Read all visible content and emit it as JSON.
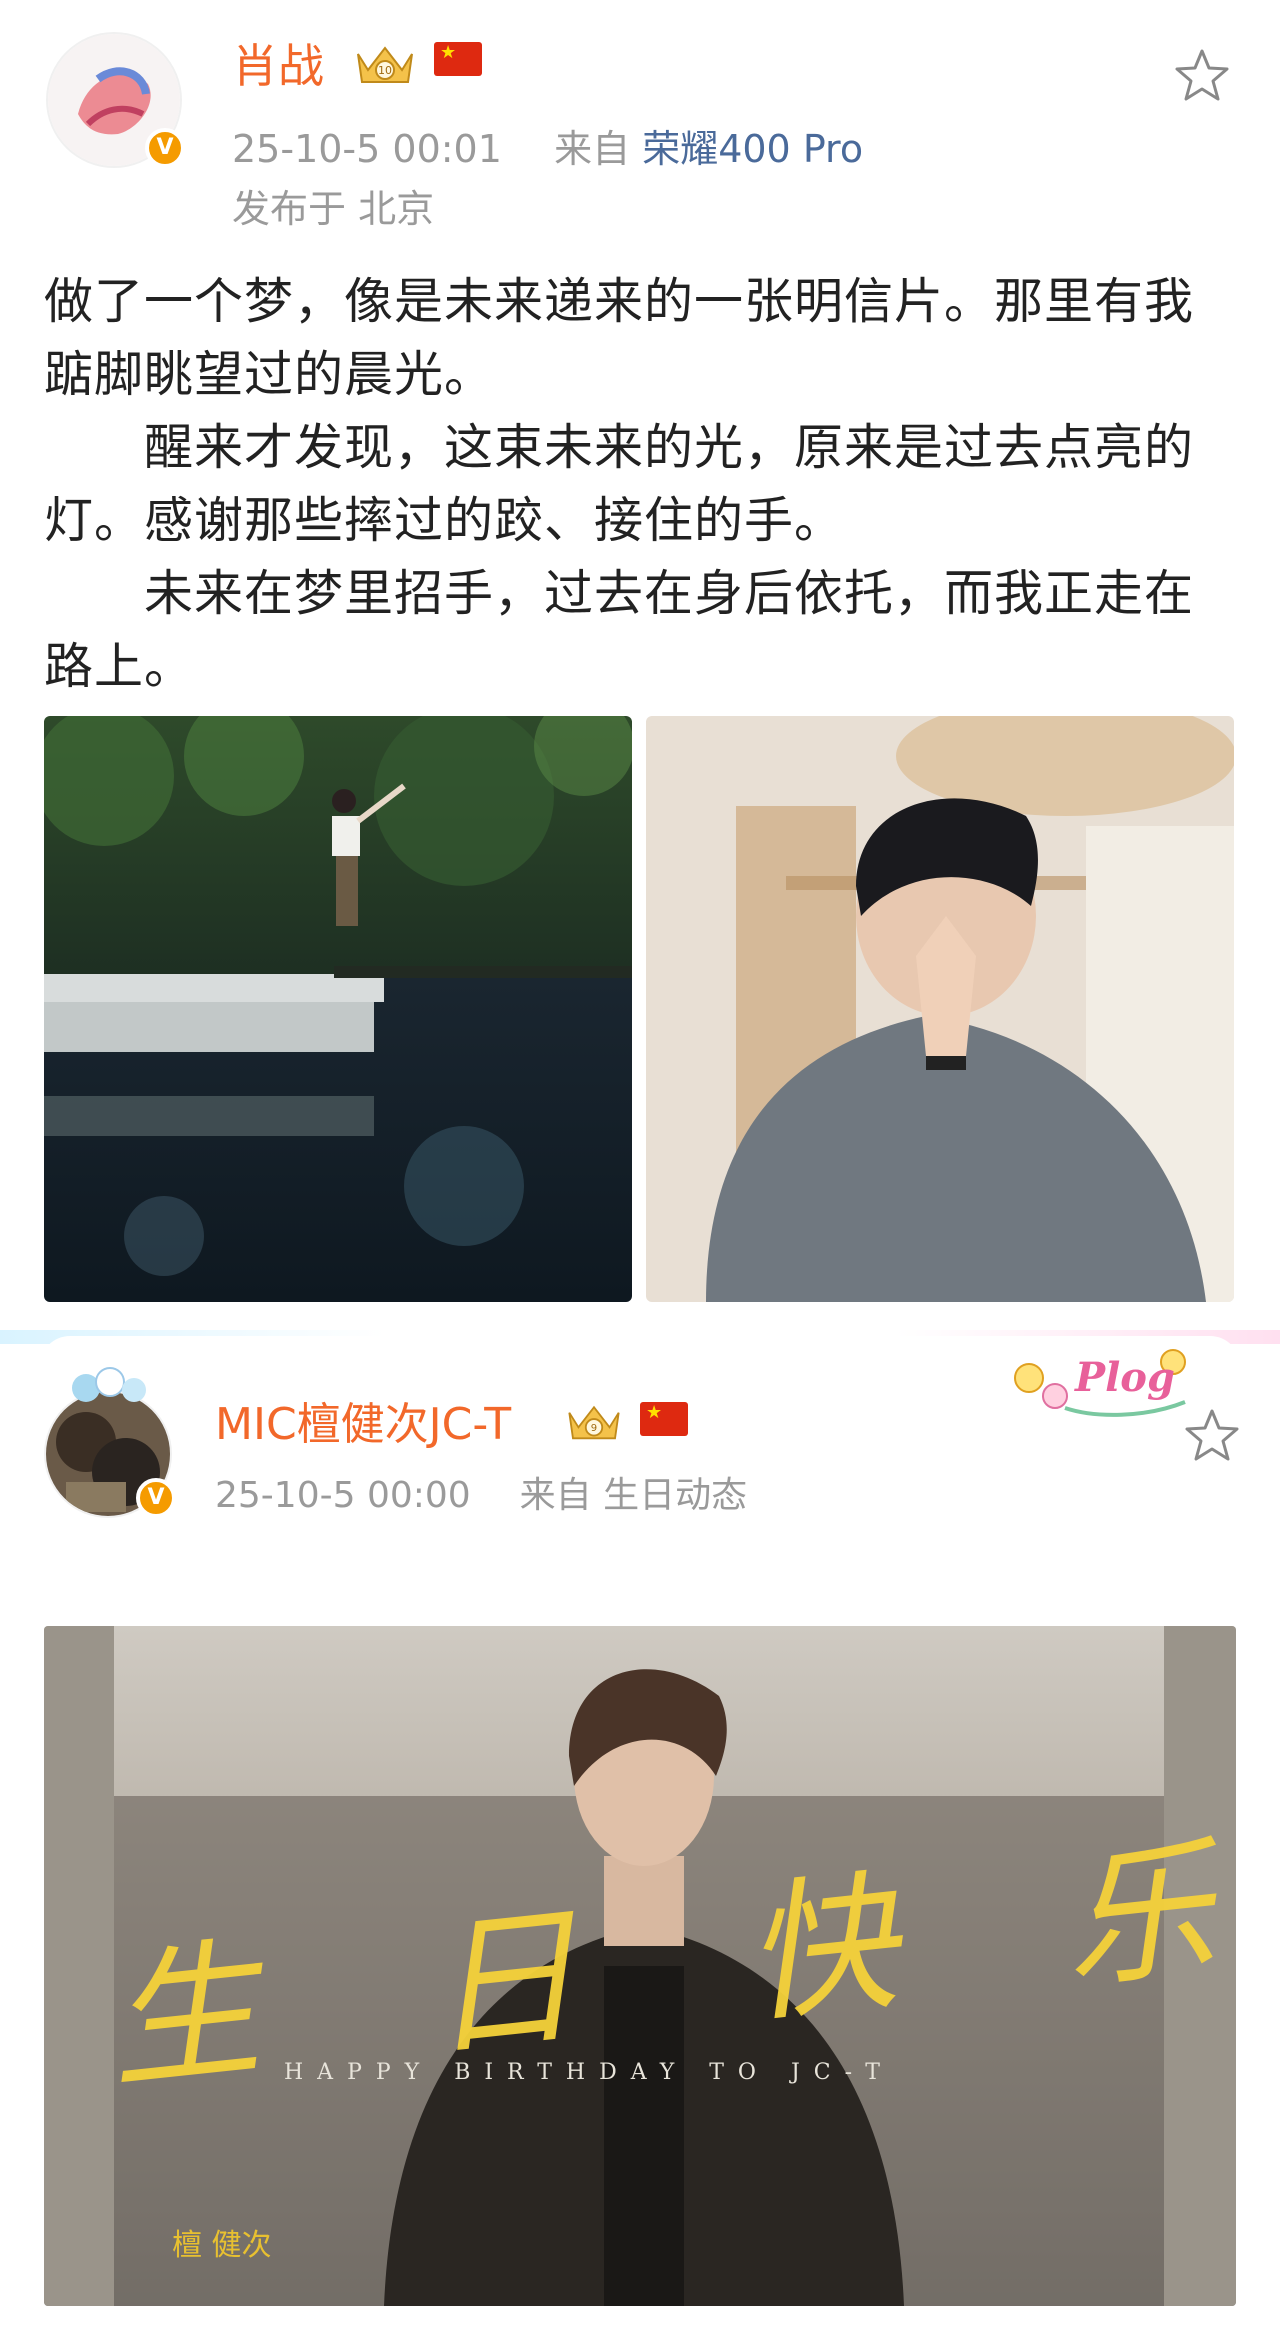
{
  "post1": {
    "username": "肖战",
    "timestamp": "25-10-5 00:01",
    "source_prefix": "来自",
    "device": "荣耀400 Pro",
    "location": "发布于 北京",
    "paragraphs": [
      "做了一个梦，像是未来递来的一张明信片。那里有我踮脚眺望过的晨光。",
      "醒来才发现，这束未来的光，原来是过去点亮的灯。感谢那些摔过的跤、接住的手。",
      "未来在梦里招手，过去在身后依托，而我正走在路上。"
    ],
    "images": [
      "lake-photo",
      "praying-photo"
    ]
  },
  "post2": {
    "username": "MIC檀健次JC-T",
    "timestamp": "25-10-5 00:00",
    "source_prefix": "来自",
    "source": "生日动态",
    "plog_label": "Plog",
    "poster": {
      "calligraphy": "生日快乐",
      "caption": "HAPPY BIRTHDAY TO JC-T",
      "signature": "檀 健次"
    }
  },
  "colors": {
    "username": "#f2682a",
    "meta": "#9a9a9a",
    "device": "#4a6a9a",
    "verified_badge": "#f59b00",
    "calligraphy": "#f5d23a"
  },
  "icons": [
    "star-icon",
    "crown-badge-icon",
    "china-flag-icon",
    "verified-icon"
  ]
}
